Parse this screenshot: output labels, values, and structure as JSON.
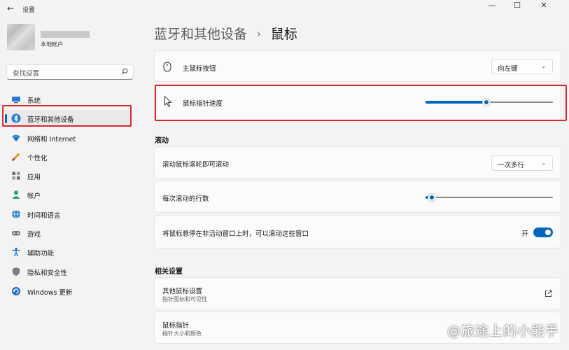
{
  "window": {
    "title": "设置",
    "back_glyph": "←",
    "minimize_glyph": "—",
    "maximize_glyph": "☐",
    "close_glyph": "✕"
  },
  "profile": {
    "account_type": "本地帐户"
  },
  "search": {
    "placeholder": "查找设置",
    "icon": "search-icon"
  },
  "sidebar": {
    "items": [
      {
        "label": "系统",
        "icon": "monitor-icon"
      },
      {
        "label": "蓝牙和其他设备",
        "icon": "bluetooth-icon",
        "active": true
      },
      {
        "label": "网络和 Internet",
        "icon": "wifi-icon"
      },
      {
        "label": "个性化",
        "icon": "brush-icon"
      },
      {
        "label": "应用",
        "icon": "apps-icon"
      },
      {
        "label": "帐户",
        "icon": "person-icon"
      },
      {
        "label": "时间和语言",
        "icon": "globe-icon"
      },
      {
        "label": "游戏",
        "icon": "gamepad-icon"
      },
      {
        "label": "辅助功能",
        "icon": "accessibility-icon"
      },
      {
        "label": "隐私和安全性",
        "icon": "shield-icon"
      },
      {
        "label": "Windows 更新",
        "icon": "update-icon"
      }
    ]
  },
  "breadcrumb": {
    "parent": "蓝牙和其他设备",
    "separator": "›",
    "current": "鼠标"
  },
  "settings": {
    "primary_button": {
      "label": "主鼠标按钮",
      "value": "向左键",
      "icon": "mouse-icon"
    },
    "pointer_speed": {
      "label": "鼠标指针速度",
      "level": 0.48,
      "icon": "pointer-icon"
    }
  },
  "scrolling": {
    "title": "滚动",
    "scroll_mode": {
      "label": "滚动鼠标滚轮即可滚动",
      "value": "一次多行"
    },
    "lines_per_scroll": {
      "label": "每次滚动的行数",
      "level": 0.05
    },
    "inactive_scroll": {
      "label": "将鼠标悬停在非活动窗口上时，可以滚动这些窗口",
      "toggle_text": "开",
      "on": true
    }
  },
  "related": {
    "title": "相关设置",
    "items": [
      {
        "label": "其他鼠标设置",
        "sublabel": "指针图标和可见性",
        "icon": "external-link-icon"
      },
      {
        "label": "鼠标指针",
        "sublabel": "指针大小和颜色"
      }
    ]
  },
  "watermark": {
    "text": "@旅途上的小能手"
  },
  "colors": {
    "accent": "#0067c0",
    "highlight": "#e0262f",
    "background": "#f3f3f3"
  }
}
